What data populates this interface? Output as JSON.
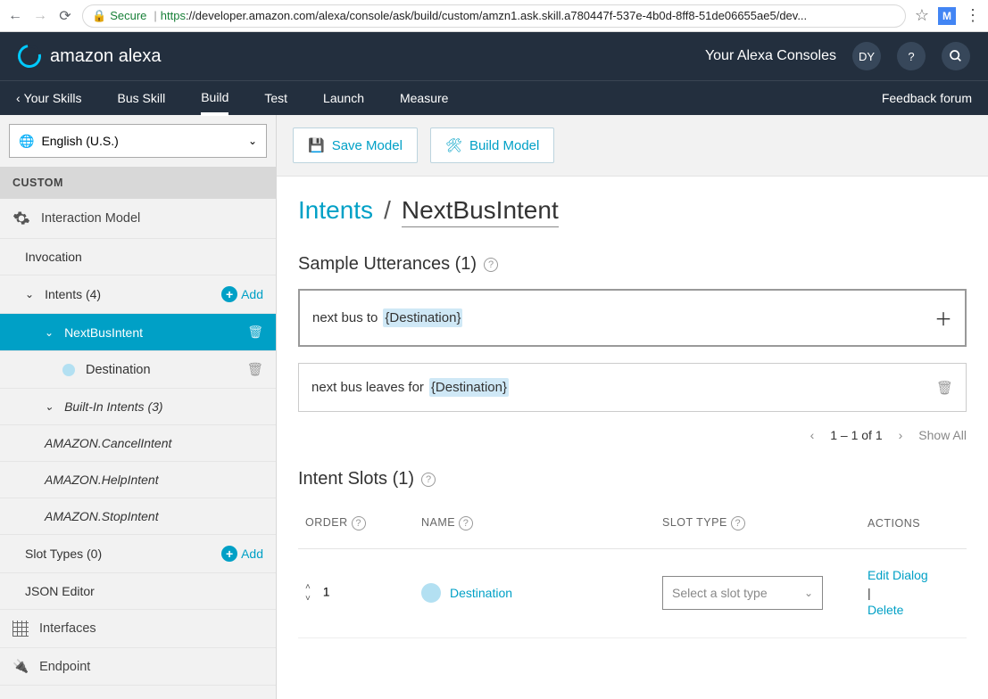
{
  "browser": {
    "secure": "Secure",
    "url_prefix": "https",
    "url_rest": "://developer.amazon.com/alexa/console/ask/build/custom/amzn1.ask.skill.a780447f-537e-4b0d-8ff8-51de06655ae5/dev...",
    "star": "☆",
    "ext_badge": "M",
    "menu_dots": "⋮"
  },
  "header": {
    "brand": "amazon alexa",
    "consoles": "Your Alexa Consoles",
    "avatar": "DY",
    "help": "?",
    "search_icon": "search"
  },
  "subnav": {
    "back_label": "Your Skills",
    "tabs": [
      "Bus Skill",
      "Build",
      "Test",
      "Launch",
      "Measure"
    ],
    "active_index": 1,
    "feedback": "Feedback forum"
  },
  "sidebar": {
    "language": "English (U.S.)",
    "custom_label": "CUSTOM",
    "interaction_model": "Interaction Model",
    "invocation": "Invocation",
    "intents_label": "Intents (4)",
    "add": "Add",
    "intent_next_bus": "NextBusIntent",
    "destination": "Destination",
    "builtin_label": "Built-In Intents (3)",
    "builtin": [
      "AMAZON.CancelIntent",
      "AMAZON.HelpIntent",
      "AMAZON.StopIntent"
    ],
    "slot_types": "Slot Types (0)",
    "json_editor": "JSON Editor",
    "interfaces": "Interfaces",
    "endpoint": "Endpoint"
  },
  "toolbar": {
    "save": "Save Model",
    "build": "Build Model"
  },
  "breadcrumb": {
    "root": "Intents",
    "sep": "/",
    "name": "NextBusIntent"
  },
  "utterances": {
    "title": "Sample Utterances (1)",
    "u1_pre": "next bus to ",
    "u1_slot": "{Destination}",
    "u2_pre": "next bus leaves for ",
    "u2_slot": "{Destination}"
  },
  "pager": {
    "range": "1 – 1 of 1",
    "show_all": "Show All"
  },
  "slots": {
    "title": "Intent Slots (1)",
    "cols": {
      "order": "ORDER",
      "name": "NAME",
      "type": "SLOT TYPE",
      "actions": "ACTIONS"
    },
    "row": {
      "order": "1",
      "name": "Destination",
      "type_placeholder": "Select a slot type"
    },
    "actions": {
      "edit": "Edit Dialog",
      "sep": "|",
      "delete": "Delete"
    }
  }
}
